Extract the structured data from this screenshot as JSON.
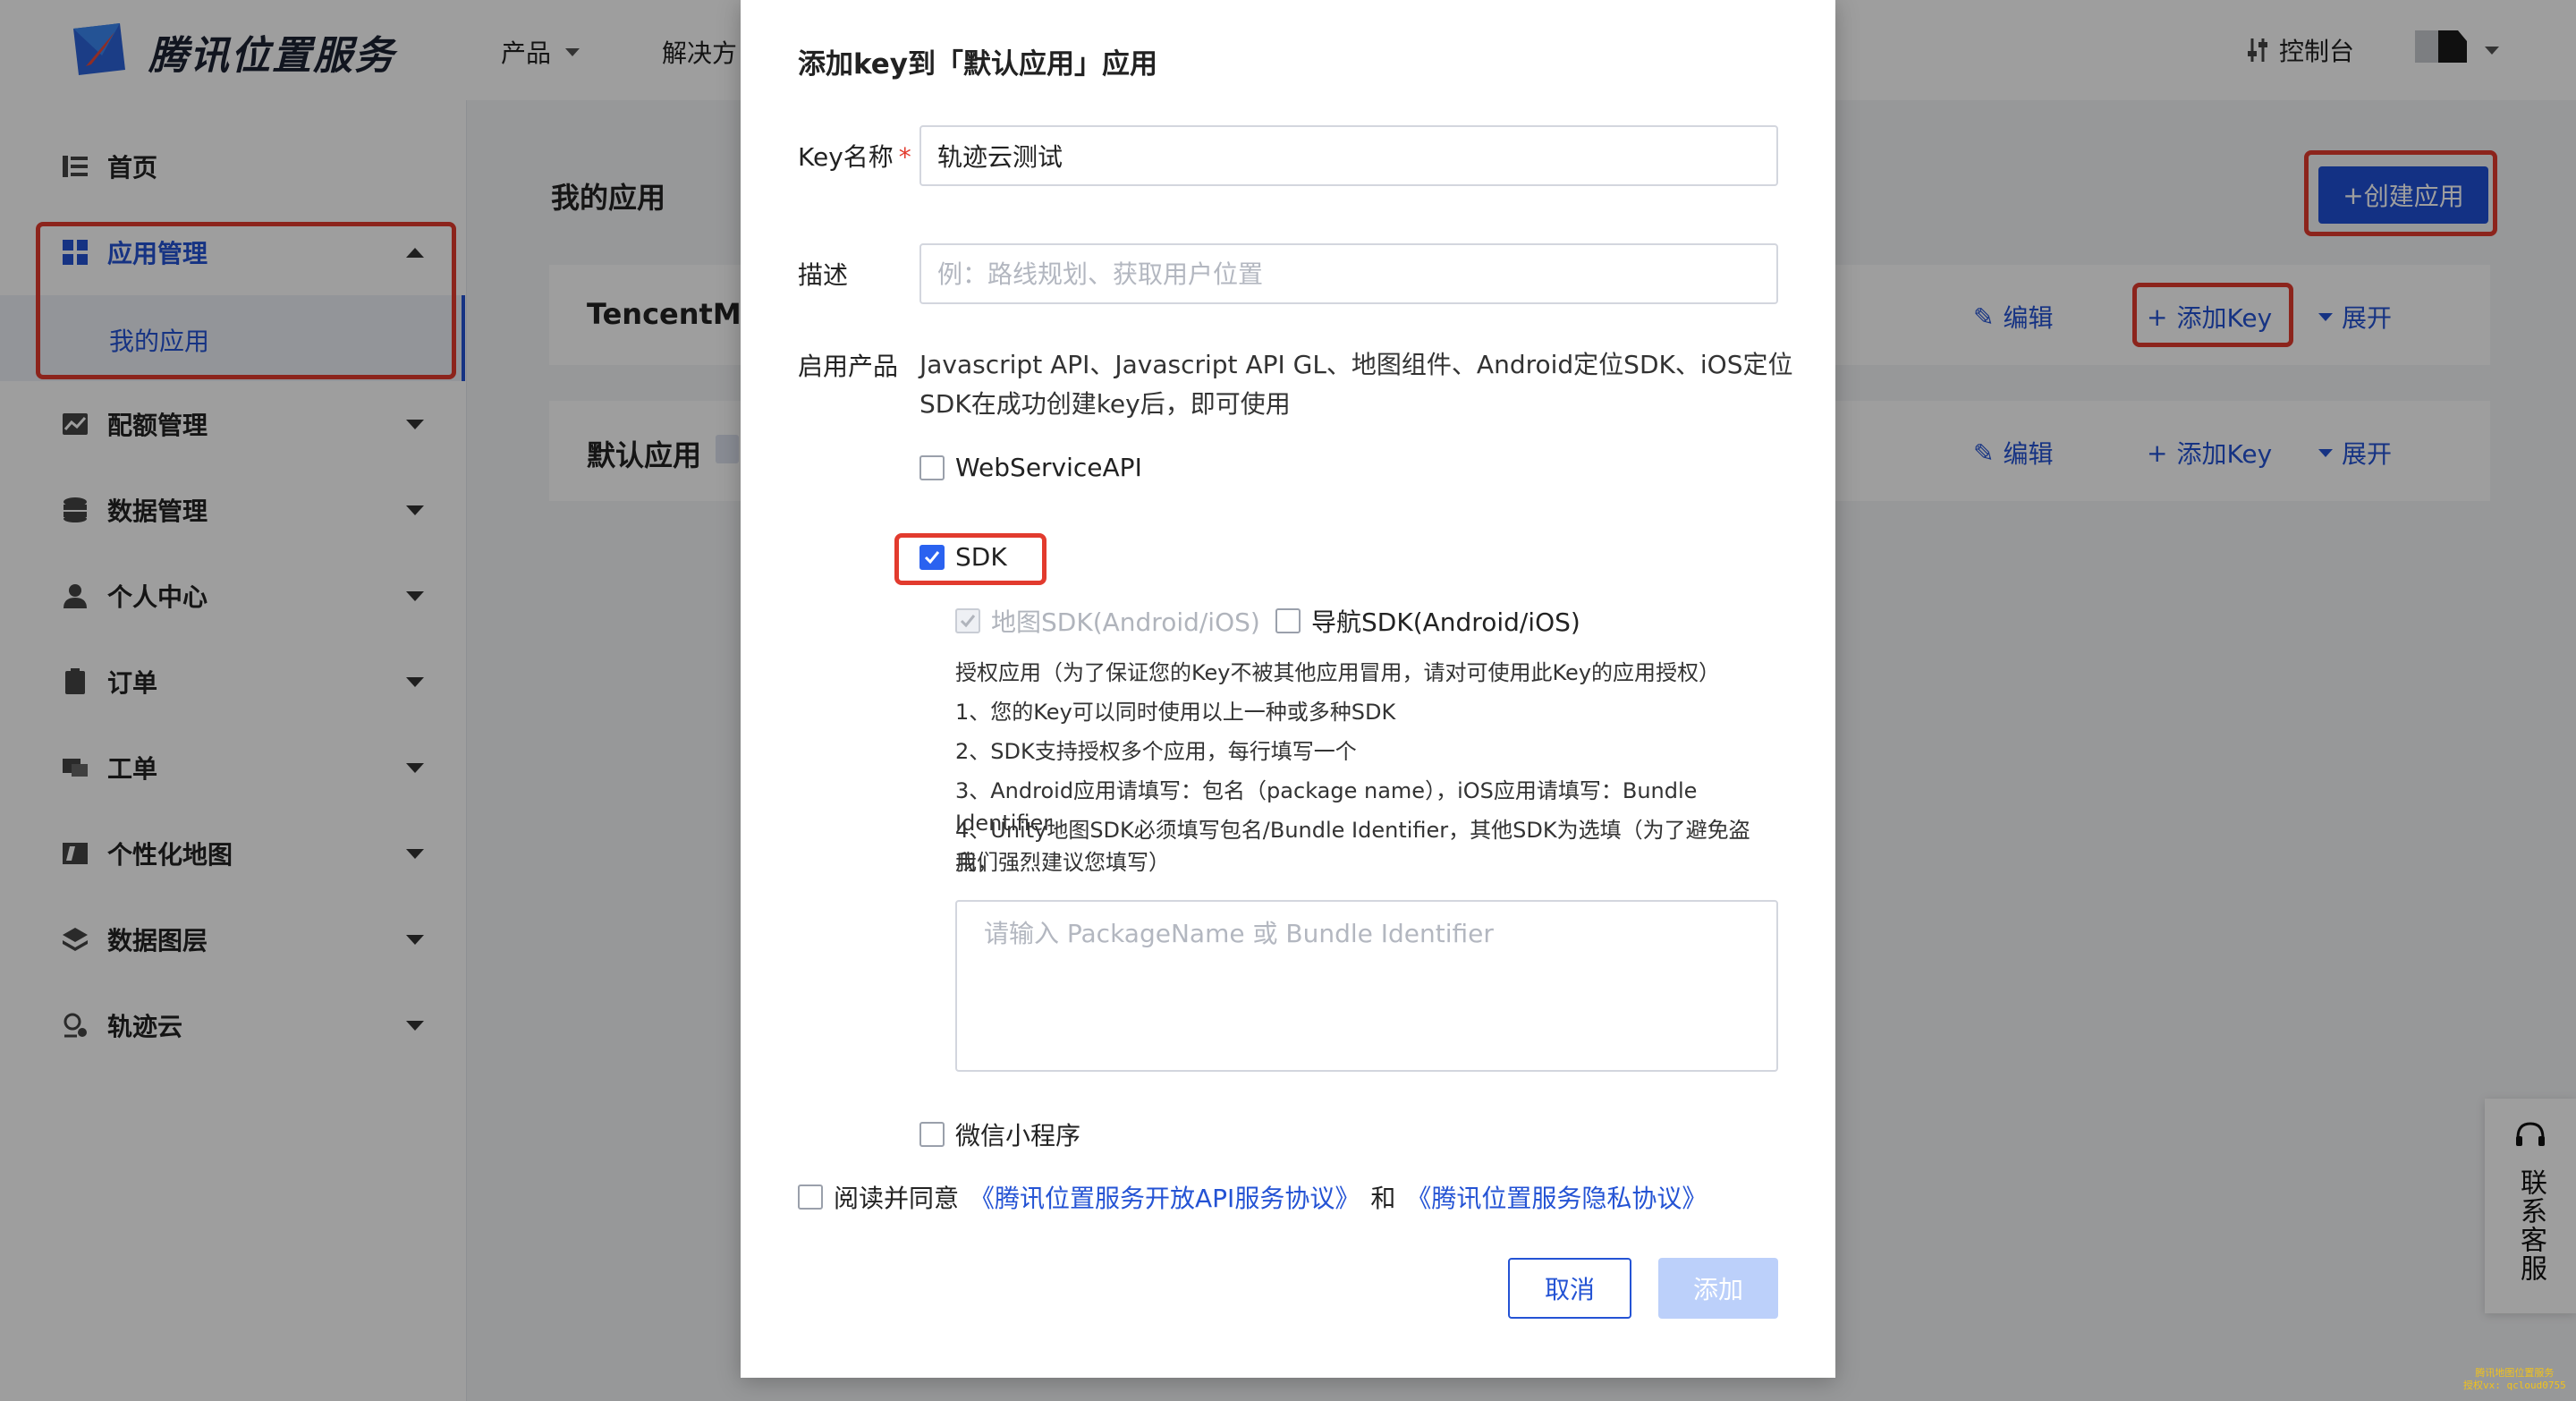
{
  "header": {
    "brand": "腾讯位置服务",
    "nav": [
      {
        "label": "产品"
      },
      {
        "label": "解决方"
      }
    ],
    "console_label": "控制台"
  },
  "sidebar": {
    "items": [
      {
        "label": "首页",
        "icon": "list-icon"
      },
      {
        "label": "应用管理",
        "icon": "grid-icon"
      },
      {
        "label": "配额管理",
        "icon": "chart-icon"
      },
      {
        "label": "数据管理",
        "icon": "database-icon"
      },
      {
        "label": "个人中心",
        "icon": "user-icon"
      },
      {
        "label": "订单",
        "icon": "clipboard-icon"
      },
      {
        "label": "工单",
        "icon": "ticket-icon"
      },
      {
        "label": "个性化地图",
        "icon": "map-style-icon"
      },
      {
        "label": "数据图层",
        "icon": "layers-icon"
      },
      {
        "label": "轨迹云",
        "icon": "track-icon"
      }
    ],
    "sub_item": "我的应用"
  },
  "main": {
    "title": "我的应用",
    "create_button": "创建应用",
    "apps": [
      {
        "name": "TencentMa",
        "edit": "编辑",
        "add_key": "添加Key",
        "expand": "展开"
      },
      {
        "name": "默认应用",
        "edit": "编辑",
        "add_key": "添加Key",
        "expand": "展开"
      }
    ]
  },
  "modal": {
    "title": "添加key到「默认应用」应用",
    "key_name_label": "Key名称",
    "required_mark": "*",
    "key_name_value": "轨迹云测试",
    "desc_label": "描述",
    "desc_placeholder": "例：路线规划、获取用户位置",
    "product_label": "启用产品",
    "product_text_line1": "Javascript API、Javascript API GL、地图组件、Android定位SDK、iOS定位",
    "product_text_line2": "SDK在成功创建key后，即可使用",
    "webservice_label": "WebServiceAPI",
    "sdk_label": "SDK",
    "map_sdk_label": "地图SDK(Android/iOS)",
    "nav_sdk_label": "导航SDK(Android/iOS)",
    "notes": [
      "授权应用（为了保证您的Key不被其他应用冒用，请对可使用此Key的应用授权）",
      "1、您的Key可以同时使用以上一种或多种SDK",
      "2、SDK支持授权多个应用，每行填写一个",
      "3、Android应用请填写：包名（package name），iOS应用请填写：Bundle Identifier",
      "4、Unity地图SDK必须填写包名/Bundle Identifier，其他SDK为选填（为了避免盗用，",
      "我们强烈建议您填写）"
    ],
    "package_placeholder": "请输入 PackageName 或 Bundle Identifier",
    "wechat_label": "微信小程序",
    "agree_prefix": "阅读并同意",
    "agree_link1": "《腾讯位置服务开放API服务协议》",
    "agree_and": "和",
    "agree_link2": "《腾讯位置服务隐私协议》",
    "cancel": "取消",
    "add": "添加"
  },
  "contact": {
    "label": "联系客服"
  },
  "watermark": {
    "line1": "腾讯地图位置服务",
    "line2": "授权vx: qcloud0755"
  },
  "colors": {
    "primary": "#2453d4",
    "highlight": "#e23b2e",
    "checkbox_on": "#2a62f0"
  }
}
